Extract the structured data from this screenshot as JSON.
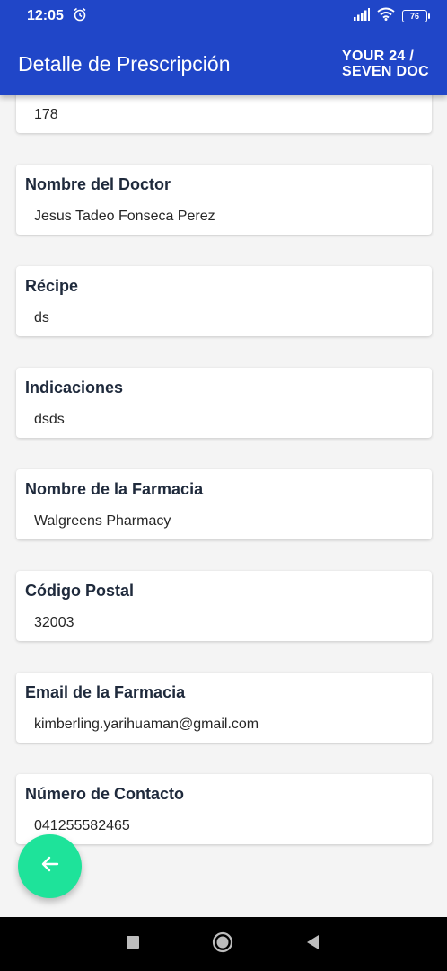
{
  "status_bar": {
    "time": "12:05",
    "battery": "76"
  },
  "app_bar": {
    "title": "Detalle de Prescripción",
    "logo_line1": "YOUR 24 /",
    "logo_line2": "SEVEN DOC"
  },
  "fields": [
    {
      "label": "",
      "value": "178"
    },
    {
      "label": "Nombre del Doctor",
      "value": "Jesus Tadeo Fonseca Perez"
    },
    {
      "label": "Récipe",
      "value": "ds"
    },
    {
      "label": "Indicaciones",
      "value": "dsds"
    },
    {
      "label": "Nombre de la Farmacia",
      "value": "Walgreens Pharmacy"
    },
    {
      "label": "Código Postal",
      "value": "32003"
    },
    {
      "label": "Email de la Farmacia",
      "value": "kimberling.yarihuaman@gmail.com"
    },
    {
      "label": "Número de Contacto",
      "value": "041255582465"
    }
  ],
  "fab": {
    "icon": "arrow-left-icon"
  },
  "colors": {
    "primary": "#2046c8",
    "accent": "#1ee39a",
    "label": "#1f2a3c"
  }
}
